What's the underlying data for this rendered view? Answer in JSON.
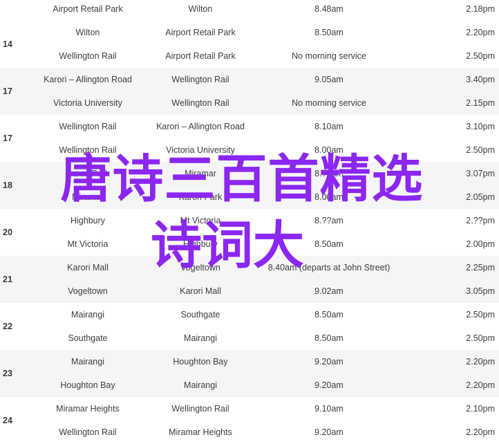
{
  "groups": [
    {
      "number": "",
      "shaded": false,
      "rows": [
        {
          "from": "Airport Retail Park",
          "to": "Wilton",
          "depart": "8.48am",
          "return": "2.18pm"
        }
      ]
    },
    {
      "number": "14",
      "shaded": false,
      "rows": [
        {
          "from": "Wilton",
          "to": "Airport Retail Park",
          "depart": "8.50am",
          "return": "2.20pm"
        },
        {
          "from": "Wellington Rail",
          "to": "Airport Retail Park",
          "depart": "No morning service",
          "return": "2.50pm"
        }
      ]
    },
    {
      "number": "17",
      "shaded": true,
      "rows": [
        {
          "from": "Karori – Allington Road",
          "to": "Wellington Rail",
          "depart": "9.05am",
          "return": "3.40pm"
        },
        {
          "from": "Victoria University",
          "to": "Wellington Rail",
          "depart": "No morning service",
          "return": "2.15pm"
        }
      ]
    },
    {
      "number": "17",
      "shaded": false,
      "rows": [
        {
          "from": "Wellington Rail",
          "to": "Karori – Allington Road",
          "depart": "8.10am",
          "return": "3.10pm"
        },
        {
          "from": "Wellington Rail",
          "to": "Victoria University",
          "depart": "8.00am",
          "return": "2.50pm"
        }
      ]
    },
    {
      "number": "18",
      "shaded": true,
      "rows": [
        {
          "from": "Karori Park",
          "to": "Miramar",
          "depart": "8.??am",
          "return": "3.07pm"
        },
        {
          "from": "Miramar",
          "to": "Karori Park",
          "depart": "8.00am",
          "return": "2.05pm"
        }
      ]
    },
    {
      "number": "20",
      "shaded": false,
      "rows": [
        {
          "from": "Highbury",
          "to": "Mt Victoria",
          "depart": "8.??am",
          "return": "2.??pm"
        },
        {
          "from": "Mt Victoria",
          "to": "Highbury",
          "depart": "8.50am",
          "return": "2.00pm"
        }
      ]
    },
    {
      "number": "21",
      "shaded": true,
      "rows": [
        {
          "from": "Karori Mall",
          "to": "Vogeltown",
          "depart": "8.40am (departs at John Street)",
          "return": "2.25pm"
        },
        {
          "from": "Vogeltown",
          "to": "Karori Mall",
          "depart": "9.02am",
          "return": "3.05pm"
        }
      ]
    },
    {
      "number": "22",
      "shaded": false,
      "rows": [
        {
          "from": "Mairangi",
          "to": "Southgate",
          "depart": "8.50am",
          "return": "2.50pm"
        },
        {
          "from": "Southgate",
          "to": "Mairangi",
          "depart": "8.50am",
          "return": "2.50pm"
        }
      ]
    },
    {
      "number": "23",
      "shaded": true,
      "rows": [
        {
          "from": "Mairangi",
          "to": "Houghton Bay",
          "depart": "9.20am",
          "return": "2.20pm"
        },
        {
          "from": "Houghton Bay",
          "to": "Mairangi",
          "depart": "9.20am",
          "return": "2.20pm"
        }
      ]
    },
    {
      "number": "24",
      "shaded": false,
      "rows": [
        {
          "from": "Miramar Heights",
          "to": "Wellington Rail",
          "depart": "9.10am",
          "return": "2.10pm"
        },
        {
          "from": "Wellington Rail",
          "to": "Miramar Heights",
          "depart": "9.20am",
          "return": "2.20pm"
        }
      ]
    }
  ],
  "overlay": {
    "line1": "唐诗三百首精选",
    "line2": "诗词大"
  },
  "colors": {
    "overlay": "#8b27f0",
    "shade": "#f4f5f7"
  }
}
